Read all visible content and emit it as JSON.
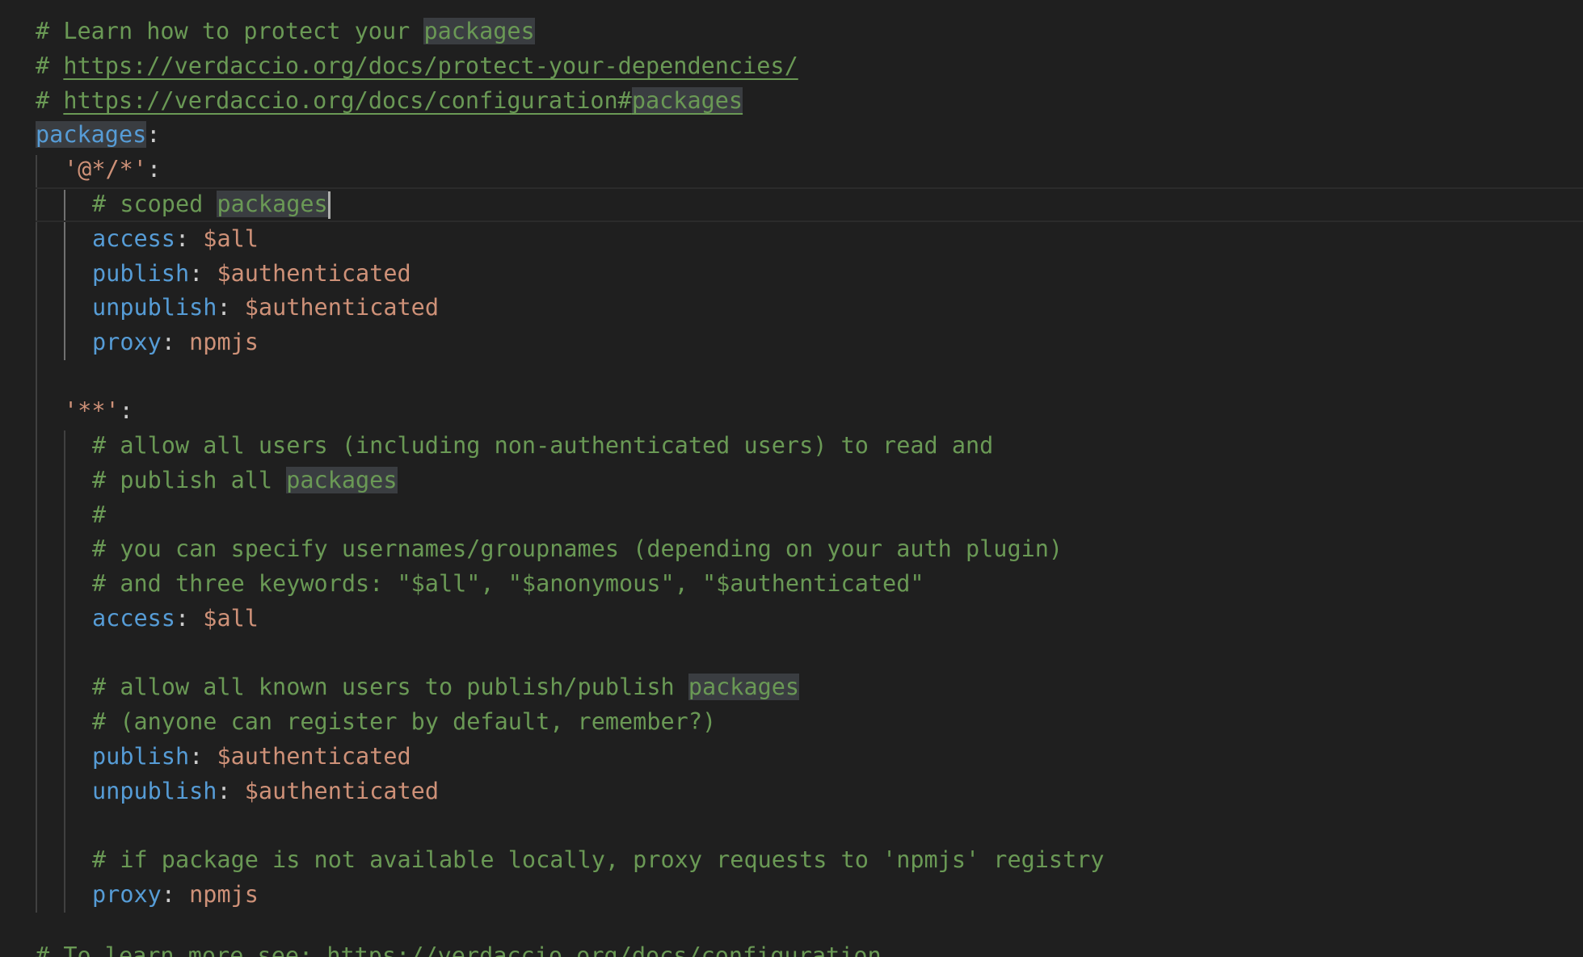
{
  "editor": {
    "language": "yaml",
    "colors": {
      "background": "#1f1f1f",
      "comment": "#6a9955",
      "key": "#569cd6",
      "value": "#ce9178",
      "selection_highlight": "#3a3d41"
    },
    "lines": {
      "l1": {
        "a": "# Learn how to protect your ",
        "b": "packages"
      },
      "l2": {
        "a": "# ",
        "b": "https://verdaccio.org/docs/protect-your-dependencies/"
      },
      "l3": {
        "a": "# ",
        "b": "https://verdaccio.org/docs/configuration#",
        "c": "packages"
      },
      "l4": {
        "key": "packages",
        "punc": ":"
      },
      "l5": {
        "str": "'@*/*'",
        "punc": ":"
      },
      "l6": {
        "a": "# scoped ",
        "b": "packages"
      },
      "l7": {
        "key": "access",
        "punc": ": ",
        "val": "$all"
      },
      "l8": {
        "key": "publish",
        "punc": ": ",
        "val": "$authenticated"
      },
      "l9": {
        "key": "unpublish",
        "punc": ": ",
        "val": "$authenticated"
      },
      "l10": {
        "key": "proxy",
        "punc": ": ",
        "val": "npmjs"
      },
      "l12": {
        "str": "'**'",
        "punc": ":"
      },
      "l13": {
        "a": "# allow all users (including non-authenticated users) to read and"
      },
      "l14": {
        "a": "# publish all ",
        "b": "packages"
      },
      "l15": {
        "a": "#"
      },
      "l16": {
        "a": "# you can specify usernames/groupnames (depending on your auth plugin)"
      },
      "l17": {
        "a": "# and three keywords: \"$all\", \"$anonymous\", \"$authenticated\""
      },
      "l18": {
        "key": "access",
        "punc": ": ",
        "val": "$all"
      },
      "l20": {
        "a": "# allow all known users to publish/publish ",
        "b": "packages"
      },
      "l21": {
        "a": "# (anyone can register by default, remember?)"
      },
      "l22": {
        "key": "publish",
        "punc": ": ",
        "val": "$authenticated"
      },
      "l23": {
        "key": "unpublish",
        "punc": ": ",
        "val": "$authenticated"
      },
      "l25": {
        "a": "# if package is not available locally, proxy requests to 'npmjs' registry"
      },
      "l26": {
        "key": "proxy",
        "punc": ": ",
        "val": "npmjs"
      },
      "l28": {
        "a": "# To learn more see: https://verdaccio.org/docs/configuration..."
      }
    }
  }
}
